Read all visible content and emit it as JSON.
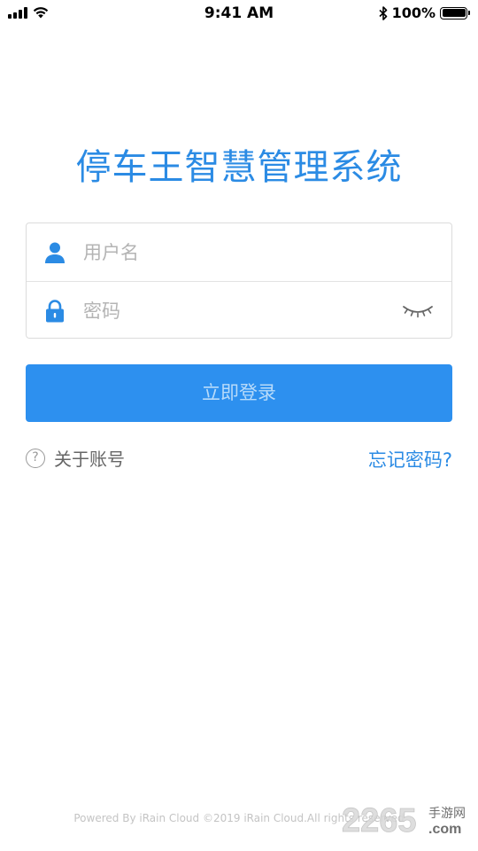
{
  "status_bar": {
    "time": "9:41 AM",
    "battery_percent": "100%",
    "signal_icon": "signal-bars-icon",
    "wifi_icon": "wifi-icon",
    "bluetooth_icon": "bluetooth-icon",
    "battery_icon": "battery-icon"
  },
  "app": {
    "title": "停车王智慧管理系统"
  },
  "login_form": {
    "username_placeholder": "用户名",
    "username_value": "",
    "username_icon": "user-icon",
    "password_placeholder": "密码",
    "password_value": "",
    "password_icon": "lock-icon",
    "password_toggle_icon": "eye-closed-icon",
    "submit_label": "立即登录"
  },
  "links": {
    "about_label": "关于账号",
    "about_icon": "question-circle-icon",
    "forgot_label": "忘记密码?"
  },
  "footer": {
    "text": "Powered By iRain Cloud ©2019 iRain Cloud.All rights reserved"
  },
  "watermark": {
    "number": "2265",
    "site_cn": "手游网",
    "domain": ".com"
  },
  "colors": {
    "accent": "#2b8be4",
    "button": "#2d90ef",
    "button_text": "#b8dbfa",
    "placeholder": "#b4b4b4",
    "border": "#dcdcdc"
  }
}
